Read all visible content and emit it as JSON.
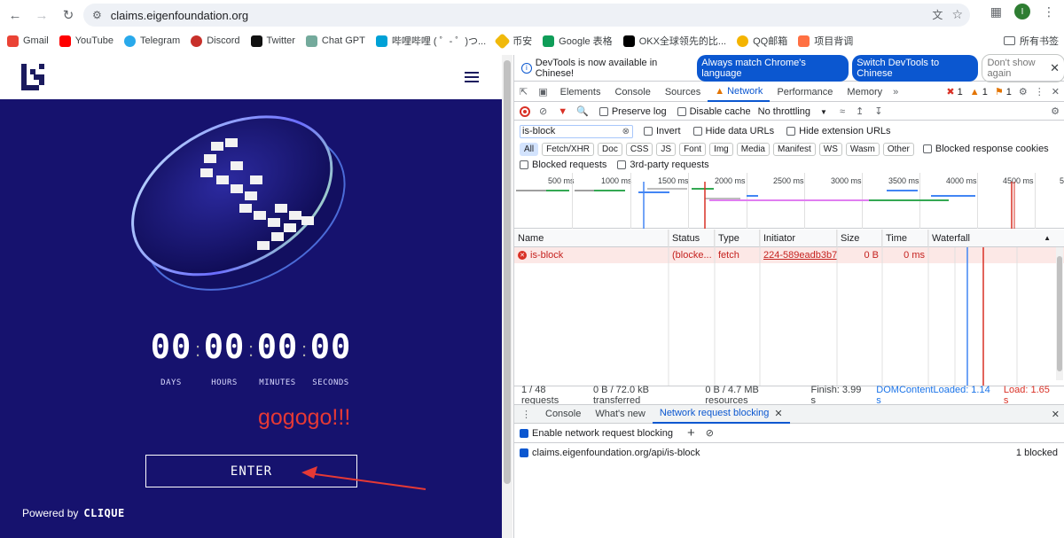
{
  "browser": {
    "url": "claims.eigenfoundation.org",
    "avatar_letter": "I",
    "bookmarks": [
      {
        "label": "Gmail",
        "color": "#ea4335"
      },
      {
        "label": "YouTube",
        "color": "#ff0000"
      },
      {
        "label": "Telegram",
        "color": "#29a9eb"
      },
      {
        "label": "Discord",
        "color": "#c8302a"
      },
      {
        "label": "Twitter",
        "color": "#111111"
      },
      {
        "label": "Chat GPT",
        "color": "#74aa9c"
      },
      {
        "label": "哔哩哔哩 ( ゜- ゜)つ...",
        "color": "#00a1d6"
      },
      {
        "label": "币安",
        "color": "#f0b90b"
      },
      {
        "label": "Google 表格",
        "color": "#0f9d58"
      },
      {
        "label": "OKX全球领先的比...",
        "color": "#000000"
      },
      {
        "label": "QQ邮箱",
        "color": "#f4b400"
      },
      {
        "label": "项目背调",
        "color": "#ff7043"
      }
    ],
    "bookmarks_folder": "所有书签"
  },
  "site": {
    "countdown": [
      {
        "value": "00",
        "label": "DAYS"
      },
      {
        "value": "00",
        "label": "HOURS"
      },
      {
        "value": "00",
        "label": "MINUTES"
      },
      {
        "value": "00",
        "label": "SECONDS"
      }
    ],
    "annotation": "gogogo!!!",
    "enter_label": "ENTER",
    "powered_prefix": "Powered by",
    "powered_brand": "CLIQUE"
  },
  "devtools": {
    "banner_text": "DevTools is now available in Chinese!",
    "banner_btn1": "Always match Chrome's language",
    "banner_btn2": "Switch DevTools to Chinese",
    "banner_btn3": "Don't show again",
    "tabs": [
      "Elements",
      "Console",
      "Sources",
      "Network",
      "Performance",
      "Memory"
    ],
    "errors": "1",
    "warnings": "1",
    "issues": "1",
    "preserve_log": "Preserve log",
    "disable_cache": "Disable cache",
    "throttling": "No throttling",
    "filter_value": "is-block",
    "invert": "Invert",
    "hide_data_urls": "Hide data URLs",
    "hide_ext_urls": "Hide extension URLs",
    "type_filters": [
      "All",
      "Fetch/XHR",
      "Doc",
      "CSS",
      "JS",
      "Font",
      "Img",
      "Media",
      "Manifest",
      "WS",
      "Wasm",
      "Other"
    ],
    "blocked_cookies": "Blocked response cookies",
    "blocked_requests": "Blocked requests",
    "third_party": "3rd-party requests",
    "timeline_labels": [
      "500 ms",
      "1000 ms",
      "1500 ms",
      "2000 ms",
      "2500 ms",
      "3000 ms",
      "3500 ms",
      "4000 ms",
      "4500 ms",
      "5"
    ],
    "columns": [
      "Name",
      "Status",
      "Type",
      "Initiator",
      "Size",
      "Time",
      "Waterfall"
    ],
    "row": {
      "name": "is-block",
      "status": "(blocke...",
      "type": "fetch",
      "initiator": "224-589eadb3b75...",
      "size": "0 B",
      "time": "0 ms"
    },
    "status_parts": [
      "1 / 48 requests",
      "0 B / 72.0 kB transferred",
      "0 B / 4.7 MB resources",
      "Finish: 3.99 s",
      "DOMContentLoaded: 1.14 s",
      "Load: 1.65 s"
    ],
    "drawer_tabs": [
      "Console",
      "What's new",
      "Network request blocking"
    ],
    "enable_blocking": "Enable network request blocking",
    "blocked_pattern": "claims.eigenfoundation.org/api/is-block",
    "blocked_count": "1 blocked"
  }
}
